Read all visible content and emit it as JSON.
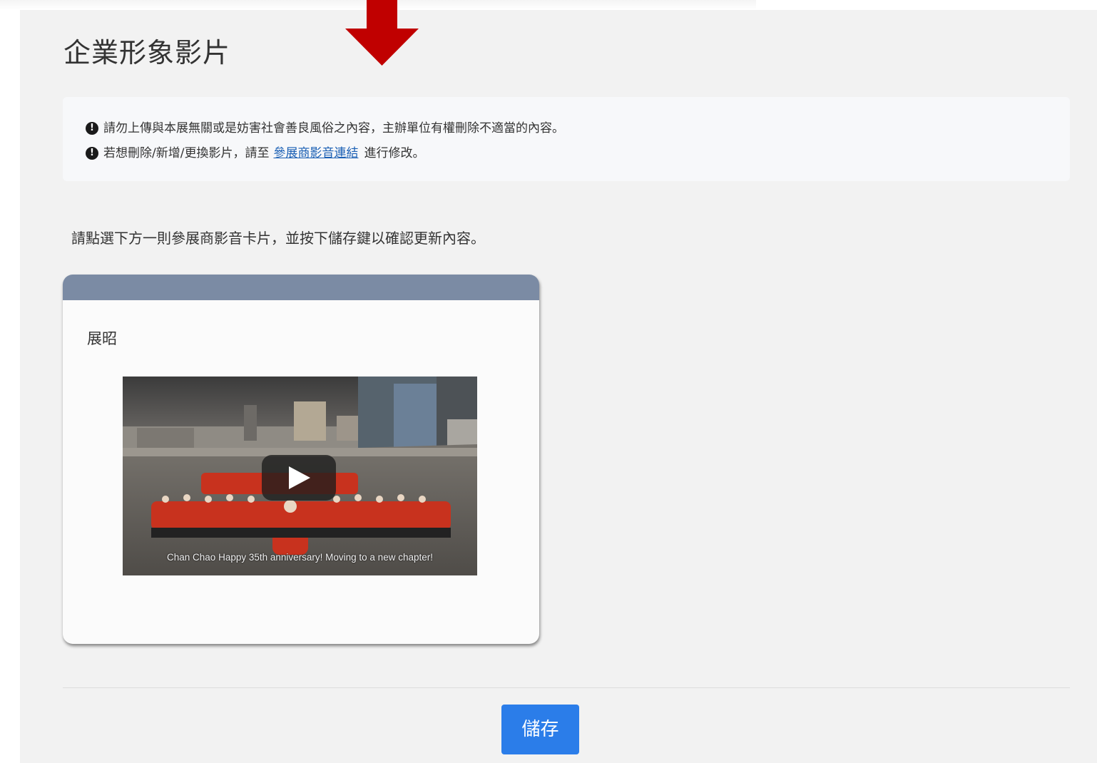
{
  "page": {
    "title": "企業形象影片"
  },
  "notices": [
    {
      "icon": "exclamation-circle-icon",
      "text": "請勿上傳與本展無關或是妨害社會善良風俗之內容，主辦單位有權刪除不適當的內容。"
    },
    {
      "icon": "exclamation-circle-icon",
      "text_before": "若想刪除/新增/更換影片，請至",
      "link_text": "參展商影音連結",
      "text_after": "進行修改。"
    }
  ],
  "instruction": "請點選下方一則參展商影音卡片，並按下儲存鍵以確認更新內容。",
  "video_card": {
    "company": "展昭",
    "video_caption": "Chan Chao Happy 35th anniversary! Moving to a new chapter!",
    "play_icon": "play-icon",
    "header_color": "#7b8ba4"
  },
  "save_button": {
    "label": "儲存",
    "color": "#2b7de9"
  },
  "annotation": {
    "arrow_icon": "arrow-down-icon",
    "color": "#c00000"
  }
}
